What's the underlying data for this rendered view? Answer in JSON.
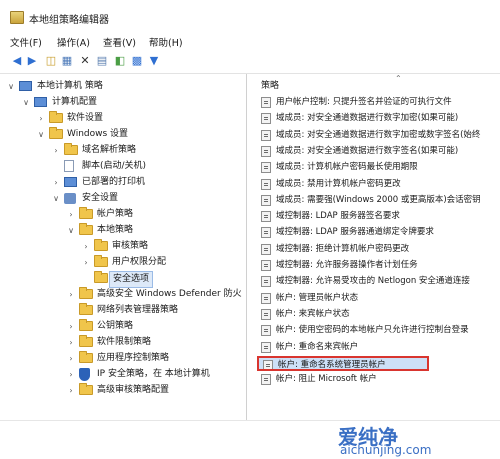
{
  "window": {
    "title": "本地组策略编辑器"
  },
  "menu": [
    "文件(F)",
    "操作(A)",
    "查看(V)",
    "帮助(H)"
  ],
  "toolbar": [
    "back-icon",
    "forward-icon",
    "up-icon",
    "show-tree-icon",
    "delete-icon",
    "properties-icon",
    "export-icon",
    "help-icon",
    "filter-icon"
  ],
  "tree": [
    {
      "label": "本地计算机 策略",
      "depth": 0,
      "icon": "computer-icon",
      "expanded": true
    },
    {
      "label": "计算机配置",
      "depth": 1,
      "icon": "computer-icon",
      "expanded": true
    },
    {
      "label": "软件设置",
      "depth": 2,
      "icon": "folder-icon",
      "expanded": false
    },
    {
      "label": "Windows 设置",
      "depth": 2,
      "icon": "folder-icon",
      "expanded": true
    },
    {
      "label": "域名解析策略",
      "depth": 3,
      "icon": "folder-icon",
      "expanded": false
    },
    {
      "label": "脚本(启动/关机)",
      "depth": 3,
      "icon": "document-icon",
      "expanded": null
    },
    {
      "label": "已部署的打印机",
      "depth": 3,
      "icon": "printer-icon",
      "expanded": false
    },
    {
      "label": "安全设置",
      "depth": 3,
      "icon": "lock-icon",
      "expanded": true
    },
    {
      "label": "帐户策略",
      "depth": 4,
      "icon": "folder-icon",
      "expanded": false
    },
    {
      "label": "本地策略",
      "depth": 4,
      "icon": "folder-icon",
      "expanded": true
    },
    {
      "label": "审核策略",
      "depth": 5,
      "icon": "folder-icon",
      "expanded": false
    },
    {
      "label": "用户权限分配",
      "depth": 5,
      "icon": "folder-icon",
      "expanded": false
    },
    {
      "label": "安全选项",
      "depth": 5,
      "icon": "folder-icon",
      "expanded": null,
      "selected": true
    },
    {
      "label": "高级安全 Windows Defender 防火",
      "depth": 4,
      "icon": "folder-icon",
      "expanded": false
    },
    {
      "label": "网络列表管理器策略",
      "depth": 4,
      "icon": "folder-icon",
      "expanded": null
    },
    {
      "label": "公钥策略",
      "depth": 4,
      "icon": "folder-icon",
      "expanded": false
    },
    {
      "label": "软件限制策略",
      "depth": 4,
      "icon": "folder-icon",
      "expanded": false
    },
    {
      "label": "应用程序控制策略",
      "depth": 4,
      "icon": "folder-icon",
      "expanded": false
    },
    {
      "label": "IP 安全策略，在 本地计算机",
      "depth": 4,
      "icon": "shield-icon",
      "expanded": false
    },
    {
      "label": "高级审核策略配置",
      "depth": 4,
      "icon": "folder-icon",
      "expanded": false
    }
  ],
  "policies_header": "策略",
  "policies": [
    "用户帐户控制: 只提升签名并验证的可执行文件",
    "域成员: 对安全通道数据进行数字加密(如果可能)",
    "域成员: 对安全通道数据进行数字加密或数字签名(始终",
    "域成员: 对安全通道数据进行数字签名(如果可能)",
    "域成员: 计算机帐户密码最长使用期限",
    "域成员: 禁用计算机帐户密码更改",
    "域成员: 需要强(Windows 2000 或更高版本)会话密钥",
    "域控制器: LDAP 服务器签名要求",
    "域控制器: LDAP 服务器通道绑定令牌要求",
    "域控制器: 拒绝计算机帐户密码更改",
    "域控制器: 允许服务器操作者计划任务",
    "域控制器: 允许易受攻击的 Netlogon 安全通道连接",
    "帐户: 管理员帐户状态",
    "帐户: 来宾帐户状态",
    "帐户: 使用空密码的本地帐户只允许进行控制台登录",
    "帐户: 重命名来宾帐户",
    "帐户: 重命名系统管理员帐户",
    "帐户: 阻止 Microsoft 帐户"
  ],
  "selected_policy_index": 16,
  "watermark": {
    "brand": "爱纯净",
    "url": "aichunjing.com"
  }
}
